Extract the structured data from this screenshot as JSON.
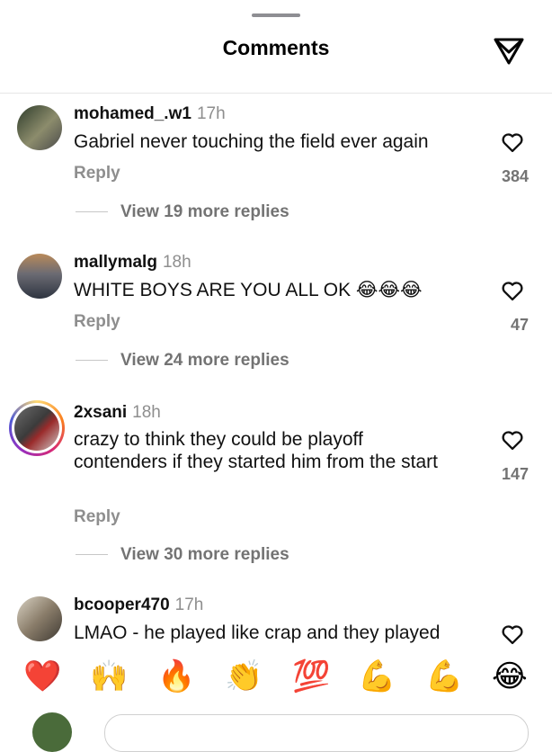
{
  "header": {
    "title": "Comments"
  },
  "comments": [
    {
      "username": "mohamed_.w1",
      "time": "17h",
      "text": "Gabriel never touching the field ever again",
      "reply": "Reply",
      "likes": "384",
      "more": "View 19 more replies"
    },
    {
      "username": "mallymalg",
      "time": "18h",
      "text": "WHITE BOYS ARE YOU ALL OK 😂😂😂",
      "reply": "Reply",
      "likes": "47",
      "more": "View 24 more replies"
    },
    {
      "username": "2xsani",
      "time": "18h",
      "text": "crazy to think they could be playoff contenders if they started him from the start",
      "reply": "Reply",
      "likes": "147",
      "more": "View 30 more replies"
    },
    {
      "username": "bcooper470",
      "time": "17h",
      "text": "LMAO - he played like crap and they played"
    }
  ],
  "emoji_bar": [
    "❤️",
    "🙌",
    "🔥",
    "👏",
    "💯",
    "💪",
    "💪",
    "😂"
  ],
  "colors": {
    "accent_ring": [
      "#feda75",
      "#d62976",
      "#4f5bd5"
    ],
    "muted_text": "#8e8e8e"
  }
}
